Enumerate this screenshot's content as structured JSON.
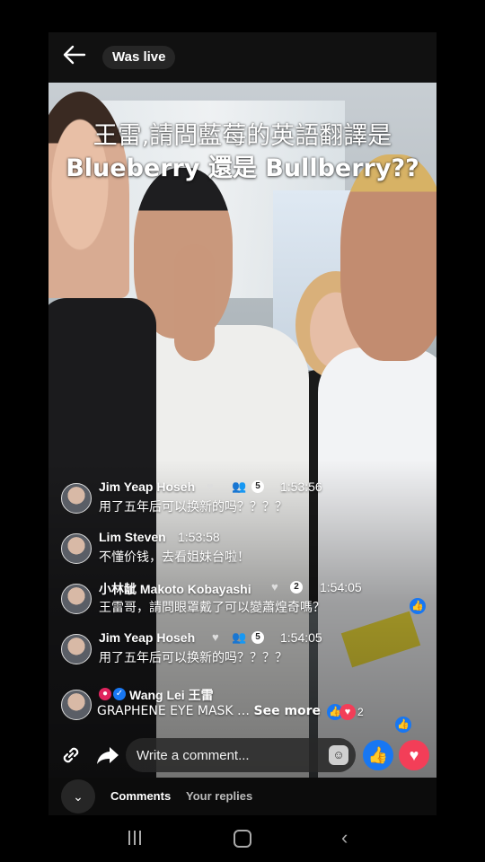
{
  "topbar": {
    "status_label": "Was live"
  },
  "video": {
    "caption_line1": "王雷,請問藍莓的英語翻譯是",
    "caption_line2": "Blueberry 還是 Bullberry??"
  },
  "comments": [
    {
      "name": "Jim Yeap Hoseh",
      "badge": "5",
      "time": "1:53:56",
      "text": "用了五年后可以换新的吗？？？？"
    },
    {
      "name": "Lim Steven",
      "time": "1:53:58",
      "text": "不懂价钱，去看姐妹台啦！"
    },
    {
      "name": "小林龇 Makoto Kobayashi",
      "badge": "2",
      "time": "1:54:05",
      "text": "王雷哥，請問眼罩戴了可以變蕭煌奇嗎？"
    },
    {
      "name": "Jim Yeap Hoseh",
      "badge": "5",
      "time": "1:54:05",
      "text": "用了五年后可以换新的吗？？？？"
    },
    {
      "name": "Wang Lei 王雷",
      "text": "GRAPHENE EYE MASK …",
      "see_more": "See more",
      "reaction_count": "2"
    }
  ],
  "composer": {
    "placeholder": "Write a comment..."
  },
  "tabs": {
    "comments": "Comments",
    "replies": "Your replies"
  },
  "colors": {
    "like": "#1877f2",
    "love": "#f33e58"
  },
  "icons": [
    "back-arrow-icon",
    "link-icon",
    "share-icon",
    "sticker-icon",
    "like-icon",
    "love-icon",
    "chevron-down-icon"
  ]
}
